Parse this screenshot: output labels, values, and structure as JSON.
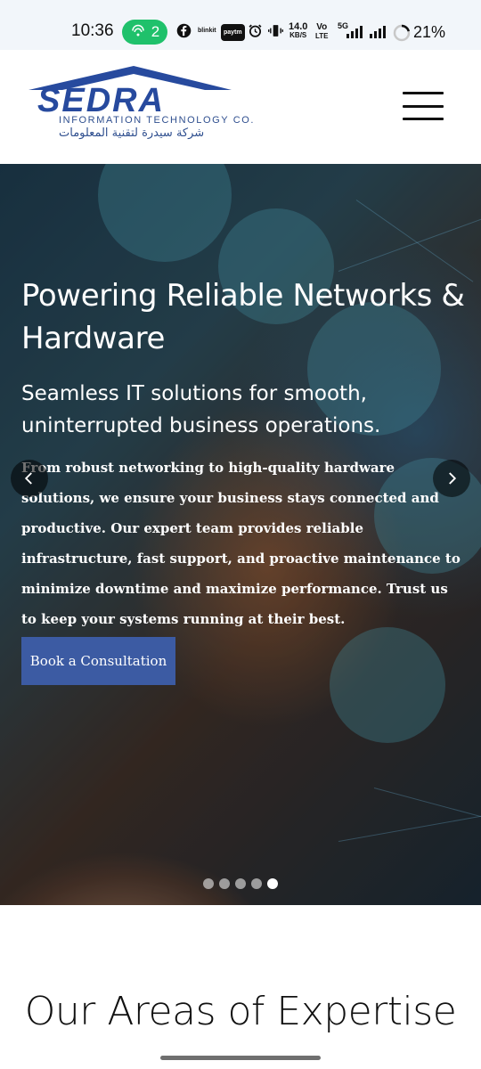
{
  "status_bar": {
    "time": "10:36",
    "hotspot_count": "2",
    "apps": [
      "blinkit",
      "paytm"
    ],
    "net_speed_value": "14.0",
    "net_speed_unit": "KB/S",
    "volte_top": "Vo",
    "volte_bottom": "LTE",
    "network": "5G",
    "battery_percent": "21%",
    "battery_level": 0.21
  },
  "header": {
    "logo_word": "SEDRA",
    "logo_subtitle": "INFORMATION TECHNOLOGY CO.",
    "logo_arabic": "شركة سيدرة لتقنية المعلومات"
  },
  "hero": {
    "title": "Powering Reliable Networks & Hardware",
    "subtitle": "Seamless IT solutions for smooth, uninterrupted business operations.",
    "body": "From robust networking to high-quality hardware solutions, we ensure your business stays connected and productive. Our expert team provides reliable infrastructure, fast support, and proactive maintenance to minimize downtime and maximize performance. Trust us to keep your systems running at their best.",
    "cta_label": "Book a Consultation",
    "slide_count": 5,
    "active_slide": 5
  },
  "section": {
    "title": "Our Areas of Expertise"
  },
  "colors": {
    "brand_blue": "#274a9e",
    "cta_blue": "#3c5ba3",
    "hotspot_green": "#1fc16b"
  }
}
